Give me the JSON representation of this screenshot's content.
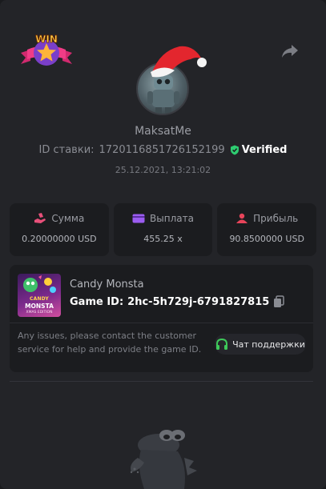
{
  "badge": {
    "text": "WIN"
  },
  "player": {
    "username": "MaksatMe",
    "bet_id_label": "ID ставки:",
    "bet_id": "1720116851726152199",
    "verified_label": "Verified",
    "date": "25.12.2021, 13:21:02"
  },
  "stats": [
    {
      "label": "Сумма",
      "value": "0.20000000 USD",
      "icon": "money-hand-icon",
      "color": "#e8507a"
    },
    {
      "label": "Выплата",
      "value": "455.25 x",
      "icon": "wallet-card-icon",
      "color": "#9b5cf0"
    },
    {
      "label": "Прибыль",
      "value": "90.8500000 USD",
      "icon": "profit-person-icon",
      "color": "#e8445a"
    }
  ],
  "game": {
    "title": "Candy Monsta",
    "id_label": "Game ID:",
    "id_value": "2hc-5h729j-6791827815",
    "thumb_line1": "CANDY",
    "thumb_line2": "MONSTA",
    "thumb_line3": "XMAS EDITION"
  },
  "support": {
    "message": "Any issues, please contact the customer service for help and provide the game ID.",
    "button_label": "Чат поддержки"
  },
  "colors": {
    "verified_green": "#2ecc71",
    "support_green": "#3ec95a",
    "background": "#232428"
  }
}
